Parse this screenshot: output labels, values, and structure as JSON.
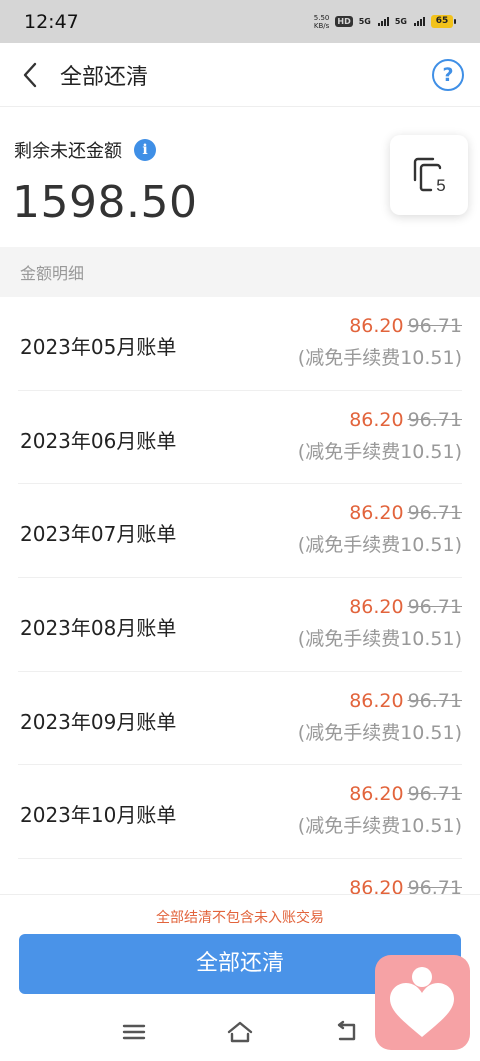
{
  "status_bar": {
    "time": "12:47",
    "net_speed_value": "5.50",
    "net_speed_unit": "KB/s",
    "hd_label": "HD",
    "net1_label": "5G",
    "net2_label": "5G",
    "battery_level": "65"
  },
  "header": {
    "title": "全部还清",
    "help_label": "?"
  },
  "summary": {
    "label": "剩余未还金额",
    "amount": "1598.50",
    "card_count": "5"
  },
  "section": {
    "title": "金额明细"
  },
  "bills": [
    {
      "name": "2023年05月账单",
      "now": "86.20",
      "original": "96.71",
      "waiver": "(减免手续费10.51)"
    },
    {
      "name": "2023年06月账单",
      "now": "86.20",
      "original": "96.71",
      "waiver": "(减免手续费10.51)"
    },
    {
      "name": "2023年07月账单",
      "now": "86.20",
      "original": "96.71",
      "waiver": "(减免手续费10.51)"
    },
    {
      "name": "2023年08月账单",
      "now": "86.20",
      "original": "96.71",
      "waiver": "(减免手续费10.51)"
    },
    {
      "name": "2023年09月账单",
      "now": "86.20",
      "original": "96.71",
      "waiver": "(减免手续费10.51)"
    },
    {
      "name": "2023年10月账单",
      "now": "86.20",
      "original": "96.71",
      "waiver": "(减免手续费10.51)"
    },
    {
      "name": "",
      "now": "86.20",
      "original": "96.71",
      "waiver": ""
    }
  ],
  "footer": {
    "notice": "全部结清不包含未入账交易",
    "button_label": "全部还清"
  },
  "colors": {
    "accent": "#4a93e8",
    "warning": "#e2643c",
    "help_icon": "#3f8fe6",
    "float_bubble": "#f6a2a5"
  }
}
